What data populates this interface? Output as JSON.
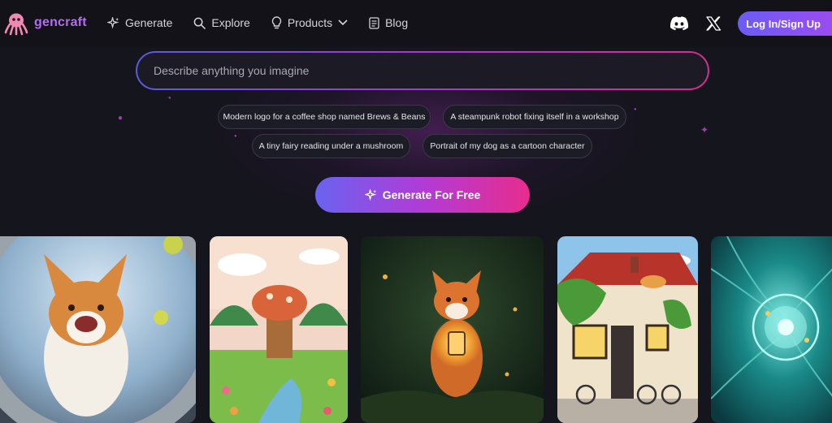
{
  "brand": {
    "name": "gencraft"
  },
  "nav": {
    "items": [
      {
        "label": "Generate",
        "icon": "sparkle-icon"
      },
      {
        "label": "Explore",
        "icon": "search-icon"
      },
      {
        "label": "Products",
        "icon": "lightbulb-icon"
      },
      {
        "label": "Blog",
        "icon": "document-icon"
      }
    ]
  },
  "header": {
    "login_label": "Log In/Sign Up"
  },
  "search": {
    "placeholder": "Describe anything you imagine"
  },
  "suggestions": [
    "Modern logo for a coffee shop named Brews & Beans",
    "A steampunk robot fixing itself in a workshop",
    "A tiny fairy reading under a mushroom",
    "Portrait of my dog as a cartoon character"
  ],
  "cta": {
    "label": "Generate For Free"
  },
  "gallery": [
    {
      "subject": "corgi-in-space-image"
    },
    {
      "subject": "mushroom-treehouse-image"
    },
    {
      "subject": "fox-with-lantern-image"
    },
    {
      "subject": "cottage-with-cat-image"
    },
    {
      "subject": "glowing-orb-image"
    }
  ],
  "colors": {
    "accent": "#b56cf0",
    "cta_start": "#6a63f0",
    "cta_end": "#e82c8e",
    "background": "#15151d"
  }
}
